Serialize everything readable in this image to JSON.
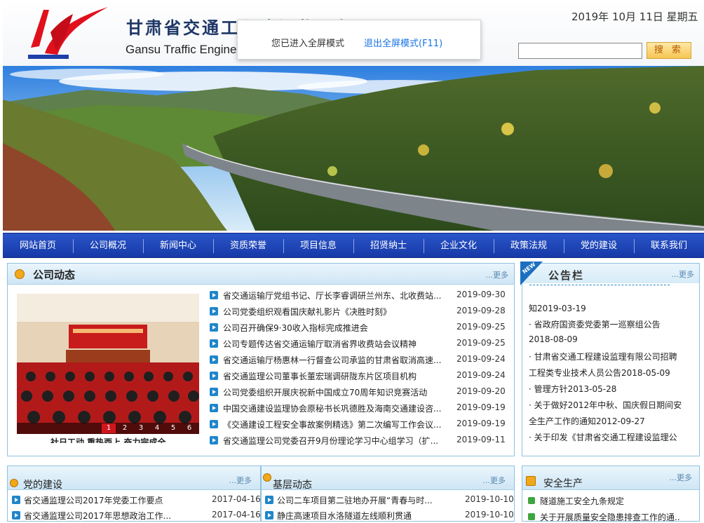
{
  "header": {
    "title_cn": "甘肃省交通工程建设监理有限公司",
    "title_en": "Gansu Traffic Engineering Construction Supervision Co., Ltd.",
    "date": "2019年 10月 11日 星期五",
    "search_button": "搜 索"
  },
  "fullscreen_popup": {
    "message": "您已进入全屏模式",
    "exit_label": "退出全屏模式(F11)"
  },
  "nav": [
    "网站首页",
    "公司概况",
    "新闻中心",
    "资质荣誉",
    "项目信息",
    "招贤纳士",
    "企业文化",
    "政策法规",
    "党的建设",
    "联系我们"
  ],
  "company_news": {
    "title": "公司动态",
    "more": "...更多",
    "photo_caption": "社日工动 重热西上 奋力完成全",
    "pager": [
      "1",
      "2",
      "3",
      "4",
      "5",
      "6"
    ],
    "items": [
      {
        "title": "省交通运输厅党组书记、厅长李睿调研兰州东、北收费站...",
        "date": "2019-09-30"
      },
      {
        "title": "公司党委组织观看国庆献礼影片《决胜时刻》",
        "date": "2019-09-28"
      },
      {
        "title": "公司召开确保9·30收入指标完成推进会",
        "date": "2019-09-25"
      },
      {
        "title": "公司专题传达省交通运输厅取消省界收费站会议精神",
        "date": "2019-09-25"
      },
      {
        "title": "省交通运输厅杨惠林一行督查公司承监的甘肃省取消高速...",
        "date": "2019-09-24"
      },
      {
        "title": "省交通监理公司董事长董宏瑞调研陇东片区项目机构",
        "date": "2019-09-24"
      },
      {
        "title": "公司党委组织开展庆祝新中国成立70周年知识竞赛活动",
        "date": "2019-09-20"
      },
      {
        "title": "中国交通建设监理协会原秘书长巩德胜及海南交通建设咨...",
        "date": "2019-09-19"
      },
      {
        "title": "《交通建设工程安全事故案例精选》第二次编写工作会议...",
        "date": "2019-09-19"
      },
      {
        "title": "省交通监理公司党委召开9月份理论学习中心组学习（扩...",
        "date": "2019-09-11"
      }
    ]
  },
  "bulletin": {
    "title": "公告栏",
    "badge": "NEW",
    "more": "...更多",
    "lines": [
      "知2019-03-19",
      "· 省政府国资委党委第一巡察组公告",
      "2018-08-09",
      "· 甘肃省交通工程建设监理有限公司招聘",
      "工程类专业技术人员公告2018-05-09",
      "· 管理方针2013-05-28",
      "· 关于做好2012年中秋、国庆假日期间安",
      "全生产工作的通知2012-09-27",
      "· 关于印发《甘肃省交通工程建设监理公"
    ]
  },
  "party": {
    "title": "党的建设",
    "more": "...更多",
    "items": [
      {
        "title": "省交通监理公司2017年党委工作要点",
        "date": "2017-04-16"
      },
      {
        "title": "省交通监理公司2017年思想政治工作...",
        "date": "2017-04-16"
      }
    ]
  },
  "grassroots": {
    "title": "基层动态",
    "more": "...更多",
    "items": [
      {
        "title": "公司二车项目第二驻地办开展“青春与时...",
        "date": "2019-10-10"
      },
      {
        "title": "静庄高速项目水洛隧道左线顺利贯通",
        "date": "2019-10-10"
      }
    ]
  },
  "safety": {
    "title": "安全生产",
    "more": "...更多",
    "items": [
      {
        "title": "隧道施工安全九条规定"
      },
      {
        "title": "关于开展质量安全隐患排查工作的通..."
      }
    ]
  },
  "colors": {
    "nav_bg": "#1a44b8",
    "accent": "#1f86c9",
    "panel_border": "#8fc1de",
    "logo_red": "#e0101c"
  }
}
